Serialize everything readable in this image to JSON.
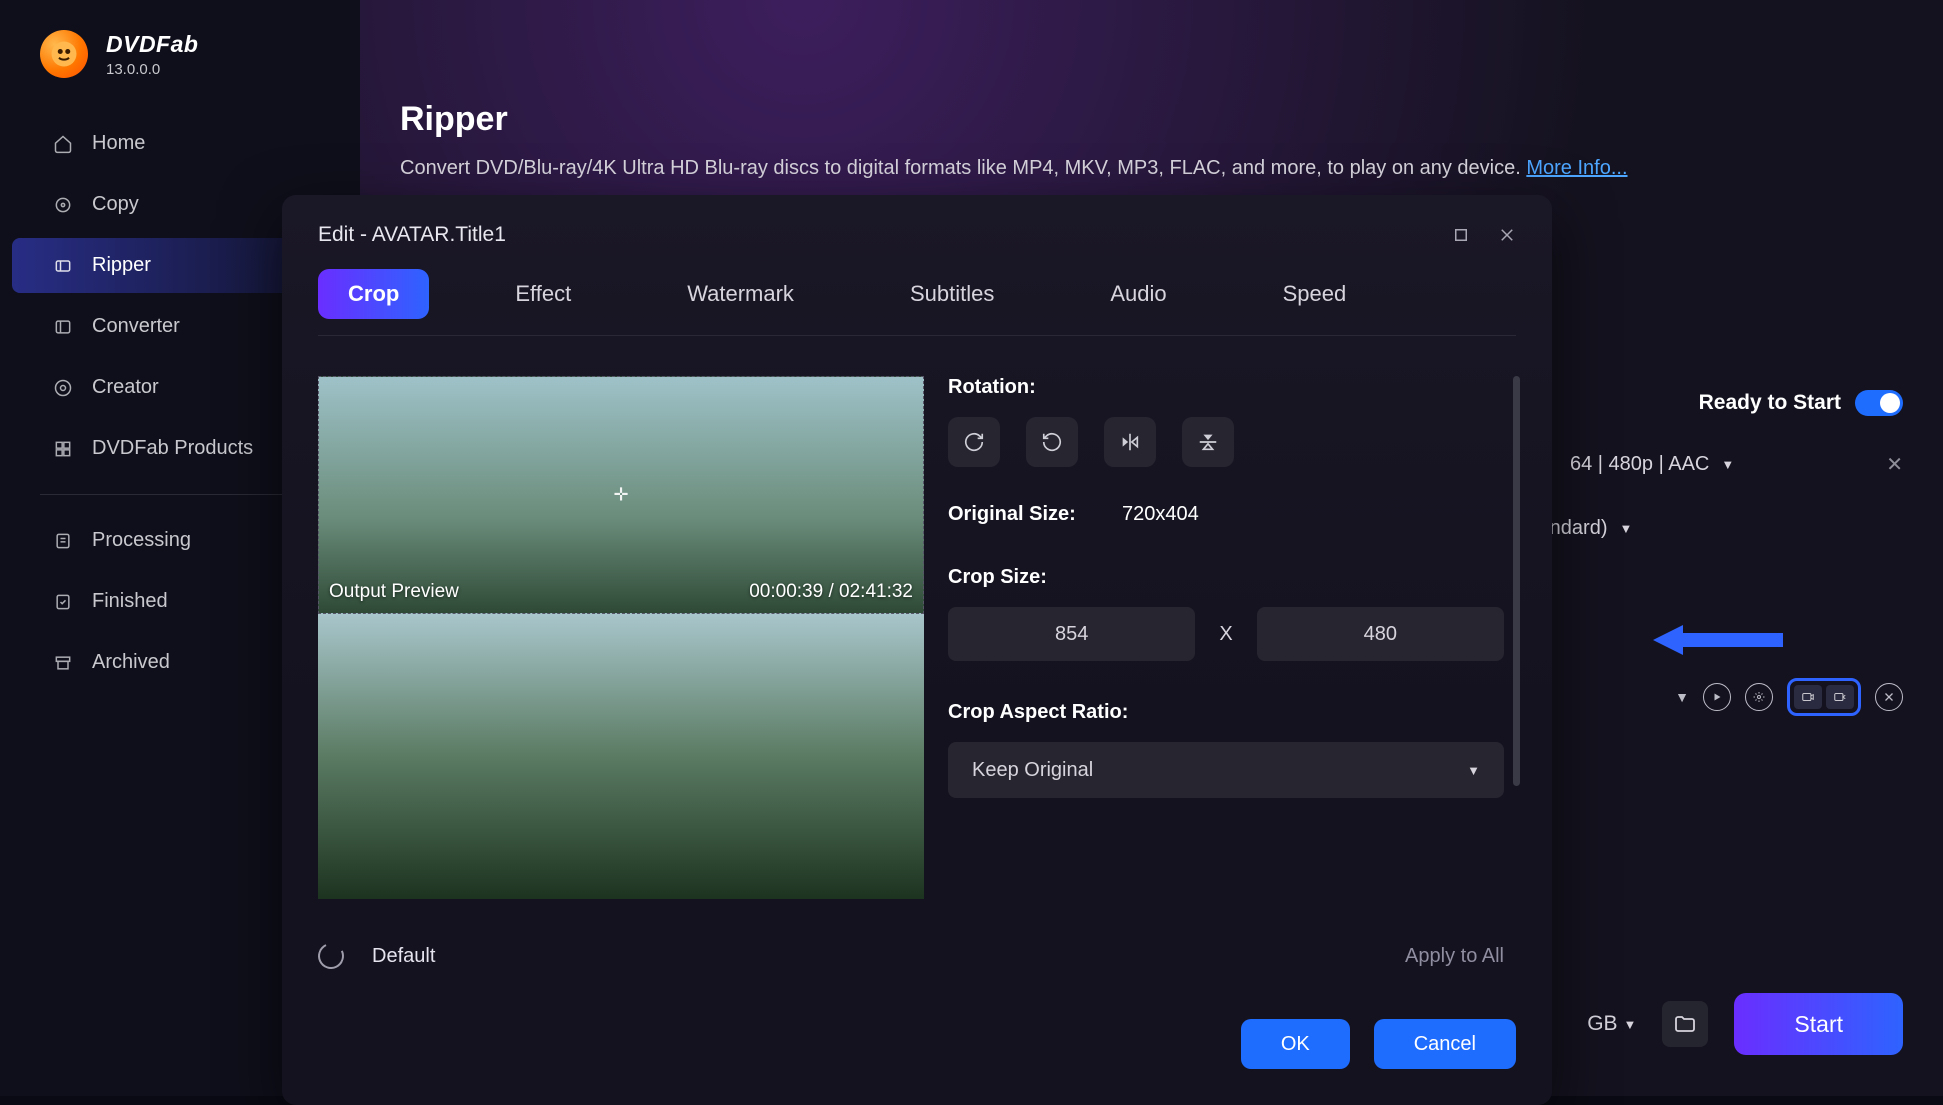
{
  "brand": {
    "name": "DVDFab",
    "version": "13.0.0.0"
  },
  "titlebar": {},
  "sidebar": {
    "items": [
      {
        "label": "Home"
      },
      {
        "label": "Copy"
      },
      {
        "label": "Ripper"
      },
      {
        "label": "Converter"
      },
      {
        "label": "Creator"
      },
      {
        "label": "DVDFab Products"
      }
    ],
    "secondary": [
      {
        "label": "Processing"
      },
      {
        "label": "Finished"
      },
      {
        "label": "Archived"
      }
    ]
  },
  "page": {
    "title": "Ripper",
    "description": "Convert DVD/Blu-ray/4K Ultra HD Blu-ray discs to digital formats like MP4, MKV, MP3, FLAC, and more, to play on any device. ",
    "more": "More Info..."
  },
  "status": {
    "ready_label": "Ready to Start"
  },
  "item": {
    "codec": "64 | 480p | AAC",
    "aspect": "(Standard)"
  },
  "footer": {
    "size": "GB",
    "start": "Start"
  },
  "modal": {
    "title": "Edit - AVATAR.Title1",
    "tabs": [
      "Crop",
      "Effect",
      "Watermark",
      "Subtitles",
      "Audio",
      "Speed"
    ],
    "preview_label": "Output Preview",
    "time": "00:00:39 / 02:41:32",
    "rotation_label": "Rotation:",
    "original_size_label": "Original Size:",
    "original_size_value": "720x404",
    "crop_size_label": "Crop Size:",
    "crop_w": "854",
    "crop_h": "480",
    "aspect_label": "Crop Aspect Ratio:",
    "aspect_value": "Keep Original",
    "default_label": "Default",
    "apply_all": "Apply to All",
    "ok": "OK",
    "cancel": "Cancel"
  }
}
